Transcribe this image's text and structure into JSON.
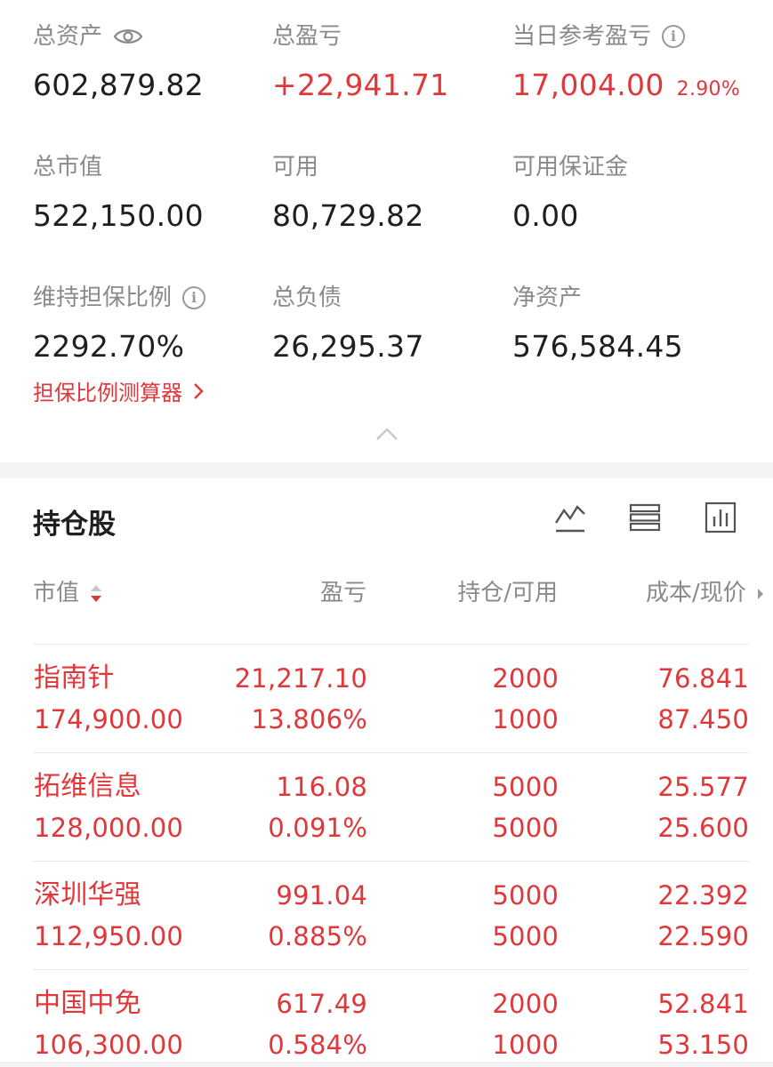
{
  "summary": {
    "total_assets_label": "总资产",
    "total_assets_value": "602,879.82",
    "total_pl_label": "总盈亏",
    "total_pl_value": "+22,941.71",
    "daily_pl_label": "当日参考盈亏",
    "daily_pl_value": "17,004.00",
    "daily_pl_pct": "2.90%",
    "market_value_label": "总市值",
    "market_value_value": "522,150.00",
    "available_label": "可用",
    "available_value": "80,729.82",
    "available_margin_label": "可用保证金",
    "available_margin_value": "0.00",
    "maintenance_ratio_label": "维持担保比例",
    "maintenance_ratio_value": "2292.70%",
    "total_liabilities_label": "总负债",
    "total_liabilities_value": "26,295.37",
    "net_assets_label": "净资产",
    "net_assets_value": "576,584.45",
    "calculator_link": "担保比例测算器"
  },
  "holdings": {
    "title": "持仓股",
    "columns": {
      "market_value": "市值",
      "pl": "盈亏",
      "position": "持仓/可用",
      "cost_price": "成本/现价"
    },
    "rows": [
      {
        "name": "指南针",
        "market_value": "174,900.00",
        "pl": "21,217.10",
        "pl_pct": "13.806%",
        "position": "2000",
        "available": "1000",
        "cost": "76.841",
        "price": "87.450"
      },
      {
        "name": "拓维信息",
        "market_value": "128,000.00",
        "pl": "116.08",
        "pl_pct": "0.091%",
        "position": "5000",
        "available": "5000",
        "cost": "25.577",
        "price": "25.600"
      },
      {
        "name": "深圳华强",
        "market_value": "112,950.00",
        "pl": "991.04",
        "pl_pct": "0.885%",
        "position": "5000",
        "available": "5000",
        "cost": "22.392",
        "price": "22.590"
      },
      {
        "name": "中国中免",
        "market_value": "106,300.00",
        "pl": "617.49",
        "pl_pct": "0.584%",
        "position": "2000",
        "available": "1000",
        "cost": "52.841",
        "price": "53.150"
      }
    ]
  },
  "icons": {
    "eye": "eye-icon",
    "info": "info-icon",
    "chevron_right": "chevron-right-icon",
    "chevron_up": "chevron-up-icon",
    "line_chart": "line-chart-icon",
    "list": "list-icon",
    "bar_chart": "bar-chart-icon"
  },
  "colors": {
    "accent_red": "#e0373b",
    "label_gray": "#8a8a8a",
    "text_dark": "#1f1f1f"
  }
}
